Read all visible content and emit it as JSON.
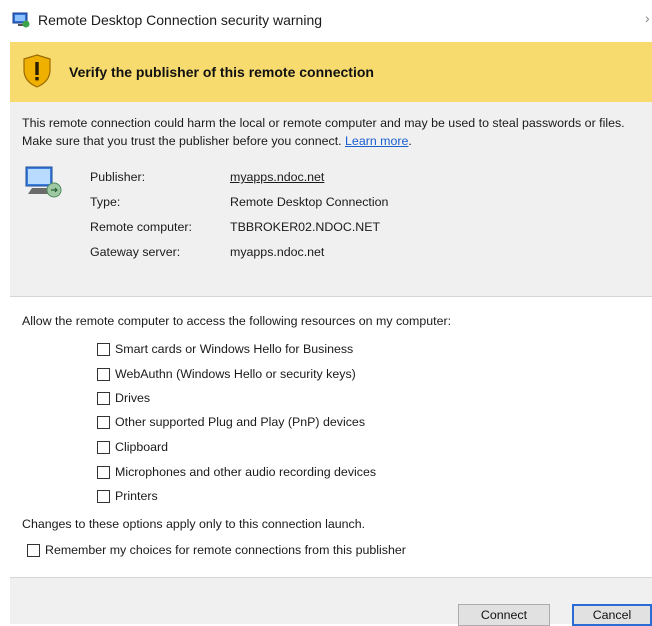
{
  "window": {
    "title": "Remote Desktop Connection security warning",
    "app_icon": "remote-desktop-icon"
  },
  "banner": {
    "icon": "shield-warning-icon",
    "text": "Verify the publisher of this remote connection",
    "color": "#f7db6e"
  },
  "warning": {
    "text": "This remote connection could harm the local or remote computer and may be used to steal passwords or files. Make sure that you trust the publisher before you connect. ",
    "link": "Learn more",
    "suffix": "."
  },
  "details": {
    "icon": "computer-connection-icon",
    "rows": [
      {
        "label": "Publisher:",
        "value": "myapps.ndoc.net",
        "is_link": true
      },
      {
        "label": "Type:",
        "value": "Remote Desktop Connection",
        "is_link": false
      },
      {
        "label": "Remote computer:",
        "value": "TBBROKER02.NDOC.NET",
        "is_link": false
      },
      {
        "label": "Gateway server:",
        "value": "myapps.ndoc.net",
        "is_link": false
      }
    ]
  },
  "resources": {
    "intro": "Allow the remote computer to access the following resources on my computer:",
    "options": [
      {
        "label": "Smart cards or Windows Hello for Business",
        "checked": false
      },
      {
        "label": "WebAuthn (Windows Hello or security keys)",
        "checked": false
      },
      {
        "label": "Drives",
        "checked": false
      },
      {
        "label": "Other supported Plug and Play (PnP) devices",
        "checked": false
      },
      {
        "label": "Clipboard",
        "checked": false
      },
      {
        "label": "Microphones and other audio recording devices",
        "checked": false
      },
      {
        "label": "Printers",
        "checked": false
      }
    ],
    "changes_note": "Changes to these options apply only to this connection launch.",
    "remember": {
      "label": "Remember my choices for remote connections from this publisher",
      "checked": false
    }
  },
  "buttons": {
    "connect": "Connect",
    "cancel": "Cancel"
  },
  "colors": {
    "link": "#1a5fd0",
    "focus": "#2b6cd4"
  }
}
